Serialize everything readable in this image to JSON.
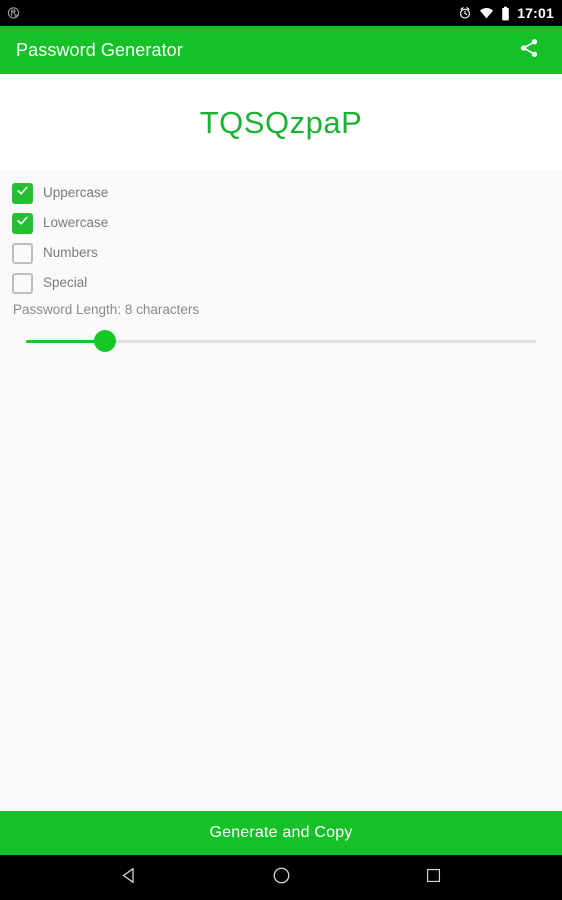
{
  "status_bar": {
    "notification_icon": "app-notification-icon",
    "alarm_icon": "alarm-clock-icon",
    "wifi_icon": "wifi-icon",
    "battery_icon": "battery-icon",
    "time": "17:01"
  },
  "app_bar": {
    "title": "Password Generator",
    "share_icon": "share-icon"
  },
  "password": {
    "value": "TQSQzpaP",
    "color": "#1db233"
  },
  "options": {
    "checkboxes": [
      {
        "label": "Uppercase",
        "checked": true
      },
      {
        "label": "Lowercase",
        "checked": true
      },
      {
        "label": "Numbers",
        "checked": false
      },
      {
        "label": "Special",
        "checked": false
      }
    ]
  },
  "length": {
    "label": "Password Length: 8 characters",
    "value": 8,
    "min": 4,
    "max": 40,
    "fill_color": "#16c726",
    "track_color": "#e2e2e2"
  },
  "generate_button": {
    "label": "Generate and Copy",
    "color": "#15c029"
  },
  "nav_bar": {
    "back_icon": "back-triangle-icon",
    "home_icon": "home-circle-icon",
    "recents_icon": "recents-square-icon"
  },
  "theme": {
    "accent": "#15c029",
    "panel_bg": "#fafafa",
    "card_bg": "#ffffff",
    "label_text": "#7b7b7b"
  }
}
